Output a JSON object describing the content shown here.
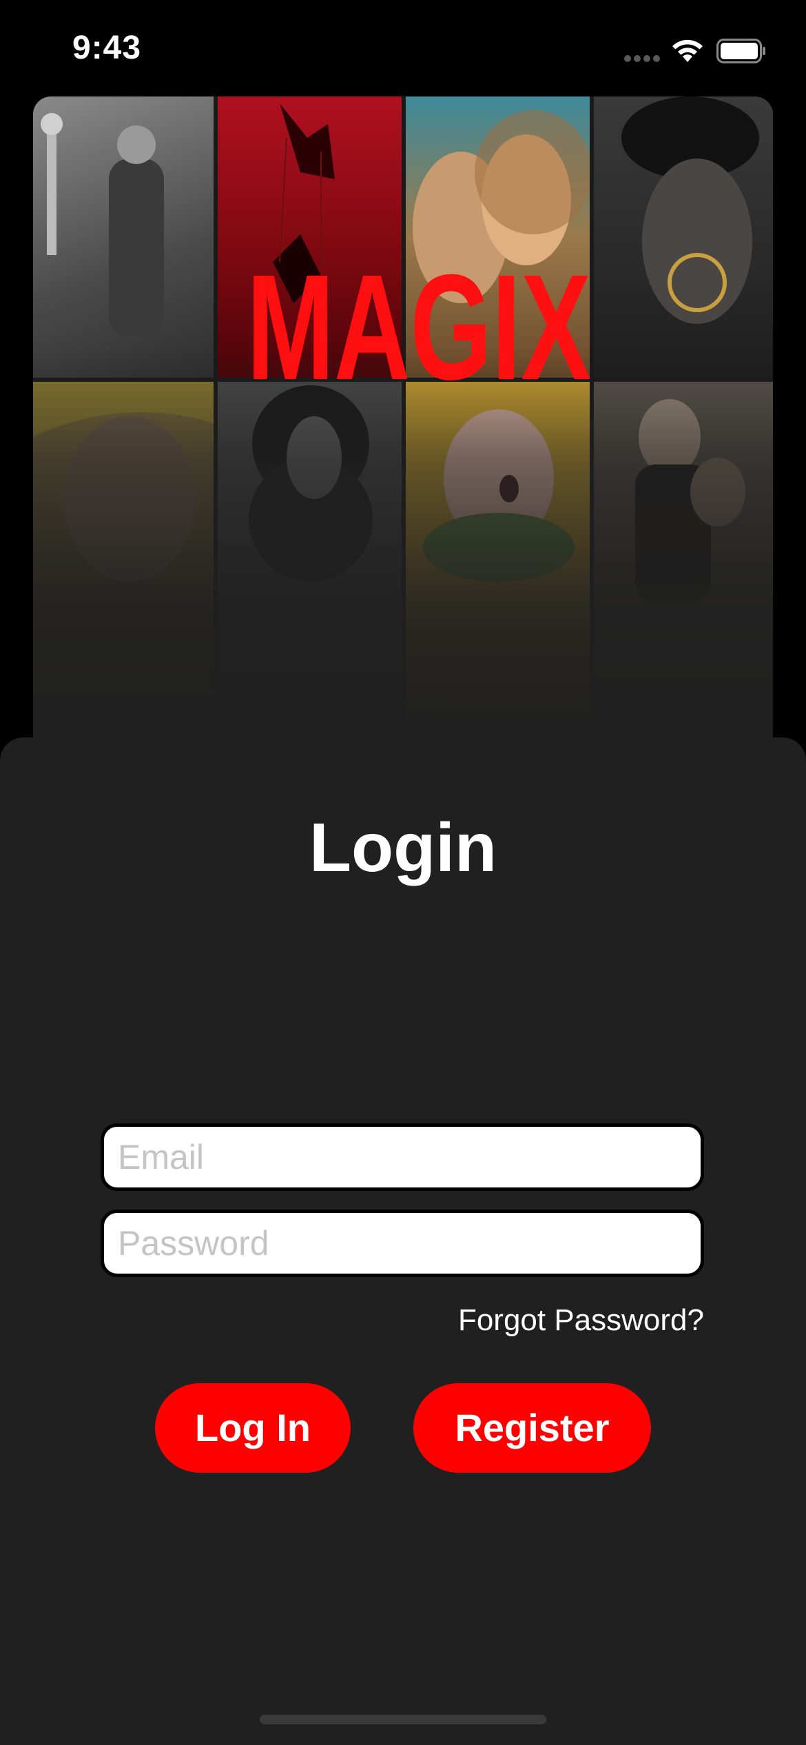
{
  "status_bar": {
    "time": "9:43"
  },
  "hero": {
    "brand": "MAGIX",
    "brand_color": "#ff1010",
    "posters": [
      {
        "tone": "#6e6e6e",
        "icon": "poster-image"
      },
      {
        "tone": "#a01018",
        "icon": "poster-image"
      },
      {
        "tone": "#8a6a3a",
        "icon": "poster-image"
      },
      {
        "tone": "#2a2a2a",
        "icon": "poster-image"
      },
      {
        "tone": "#5a5240",
        "icon": "poster-image"
      },
      {
        "tone": "#3a3a3a",
        "icon": "poster-image"
      },
      {
        "tone": "#7a6a2a",
        "icon": "poster-image"
      },
      {
        "tone": "#3a3632",
        "icon": "poster-image"
      }
    ]
  },
  "login": {
    "title": "Login",
    "email_placeholder": "Email",
    "password_placeholder": "Password",
    "forgot_label": "Forgot Password?",
    "login_label": "Log In",
    "register_label": "Register"
  },
  "colors": {
    "accent": "#ff0000",
    "sheet_background": "#202020",
    "page_background": "#000000"
  }
}
